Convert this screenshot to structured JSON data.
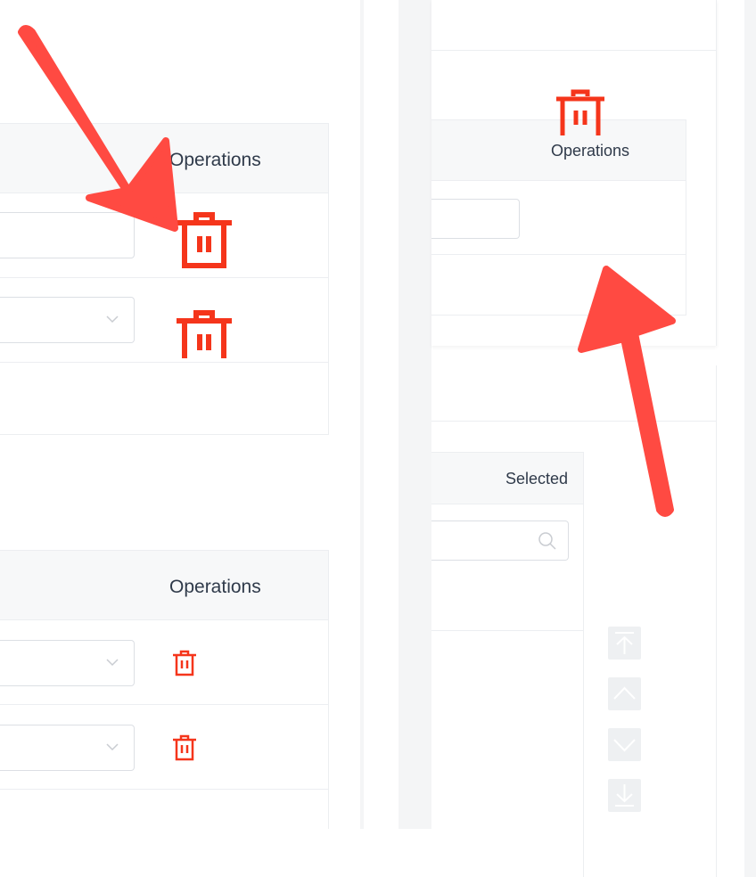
{
  "left_table_1": {
    "header": {
      "operations_label": "Operations"
    },
    "rows": [
      {
        "field_type": "text",
        "action": "trash-icon"
      },
      {
        "field_type": "select",
        "action": "trash-icon"
      },
      {
        "field_type": "empty"
      }
    ]
  },
  "left_table_2": {
    "header": {
      "operations_label": "Operations"
    },
    "rows": [
      {
        "field_type": "select",
        "action": "trash-icon"
      },
      {
        "field_type": "select",
        "action": "trash-icon"
      }
    ]
  },
  "middle_table": {
    "header": {
      "operations_label": "Operations"
    },
    "rows": [
      {
        "field_type": "text",
        "action": "trash-icon"
      },
      {
        "field_type": "empty"
      }
    ]
  },
  "transfer": {
    "header": {
      "selected_label": "Selected"
    },
    "search": {
      "placeholder": "",
      "icon": "search-icon"
    },
    "sort_buttons": [
      "move-top-icon",
      "move-up-icon",
      "move-down-icon",
      "move-bottom-icon"
    ]
  },
  "colors": {
    "danger": "#f5351b",
    "annotation_arrow": "#ff4a42",
    "header_bg": "#f7f8f9",
    "border": "#eceef1",
    "text": "#2f3a4a"
  }
}
